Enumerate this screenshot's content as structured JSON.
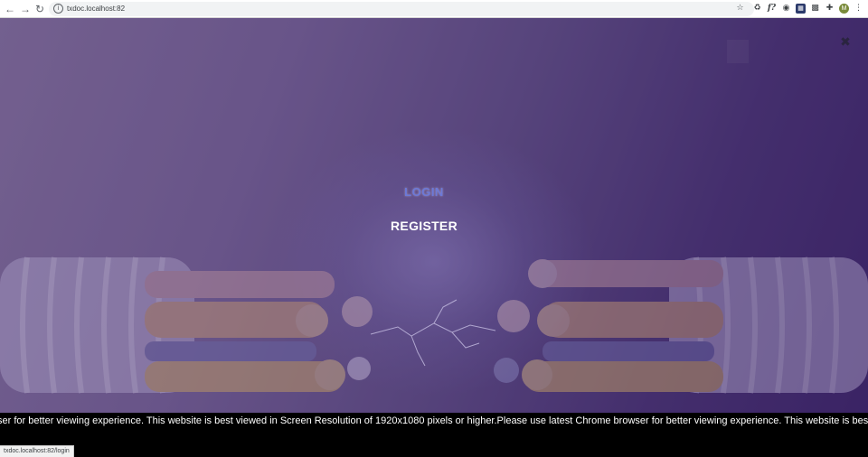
{
  "browser": {
    "url": "txdoc.localhost:82",
    "status_url": "txdoc.localhost:82/login",
    "back_icon": "arrow-left-icon",
    "forward_icon": "arrow-right-icon",
    "reload_icon": "reload-icon",
    "avatar_initial": "M",
    "ext_f": "f?"
  },
  "page": {
    "login_label": "LOGIN",
    "register_label": "REGISTER",
    "close_icon": "close-icon",
    "marquee": "ser for better viewing experience. This website is best viewed in Screen Resolution of 1920x1080 pixels or higher.Please use latest Chrome browser for better viewing experience. This website is best viewed in Screen Res"
  },
  "colors": {
    "login": "#6c79d8",
    "register": "#ffffff",
    "hero_start": "#7a6790",
    "hero_end": "#2e1658"
  }
}
